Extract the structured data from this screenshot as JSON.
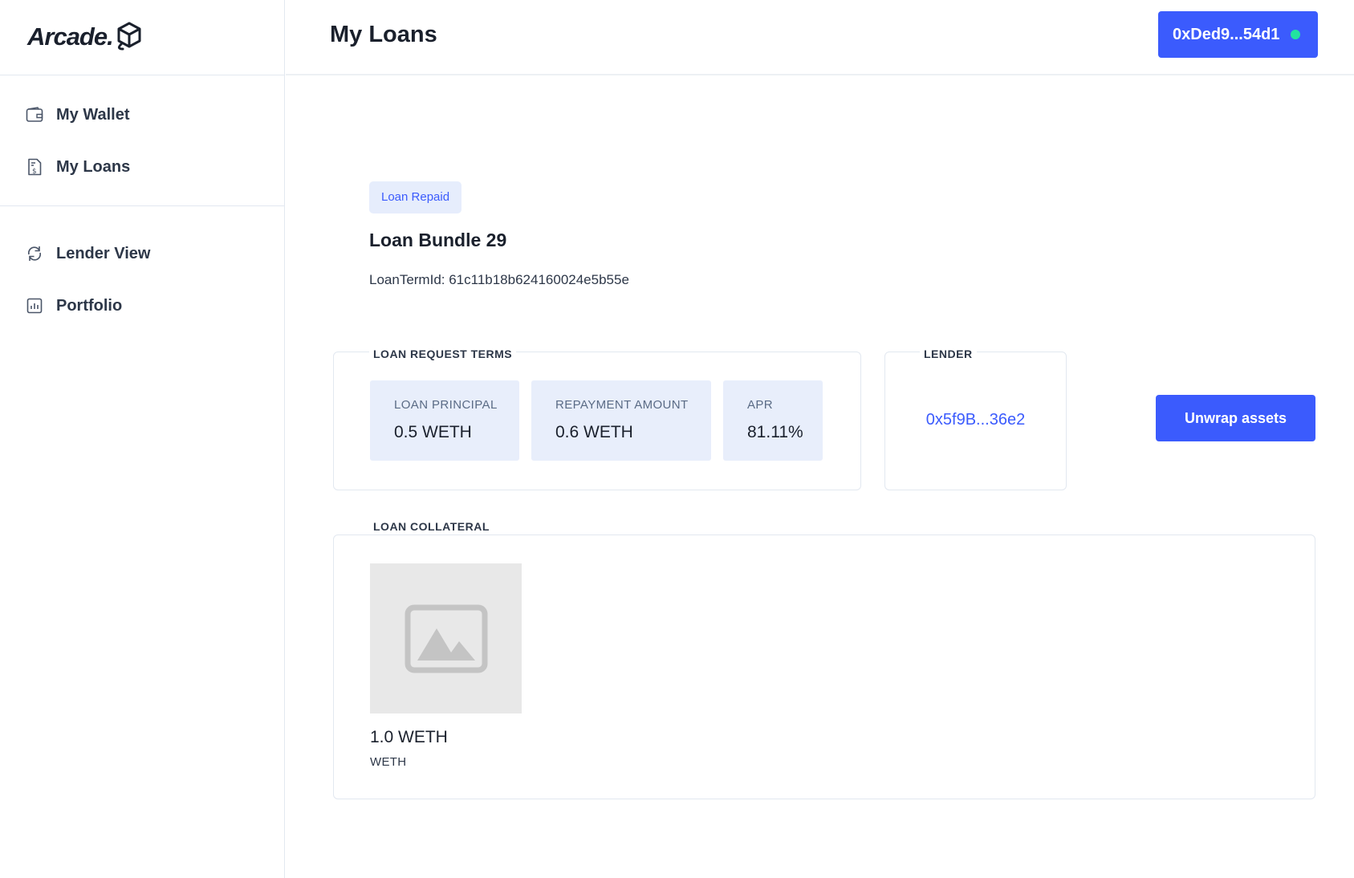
{
  "brand": {
    "name": "Arcade."
  },
  "sidebar": {
    "items": [
      {
        "label": "My Wallet",
        "icon": "wallet-icon"
      },
      {
        "label": "My Loans",
        "icon": "receipt-icon"
      },
      {
        "label": "Lender View",
        "icon": "refresh-icon"
      },
      {
        "label": "Portfolio",
        "icon": "bar-chart-icon"
      }
    ]
  },
  "header": {
    "title": "My Loans",
    "wallet_address": "0xDed9...54d1",
    "connected_color": "#22e3a0"
  },
  "loan": {
    "status": "Loan Repaid",
    "title": "Loan Bundle 29",
    "term_id": "LoanTermId: 61c11b18b624160024e5b55e",
    "terms_label": "LOAN REQUEST TERMS",
    "terms": [
      {
        "label": "LOAN PRINCIPAL",
        "value": "0.5 WETH"
      },
      {
        "label": "REPAYMENT AMOUNT",
        "value": "0.6 WETH"
      },
      {
        "label": "APR",
        "value": "81.11%"
      }
    ],
    "lender_label": "LENDER",
    "lender_address": "0x5f9B...36e2",
    "unwrap_label": "Unwrap assets",
    "collateral_label": "LOAN COLLATERAL",
    "collateral": [
      {
        "amount": "1.0 WETH",
        "symbol": "WETH",
        "image": "image-placeholder-icon"
      }
    ]
  },
  "colors": {
    "accent": "#3b5bfd",
    "badge_bg": "#e6edfc",
    "term_bg": "#e8eefb"
  }
}
